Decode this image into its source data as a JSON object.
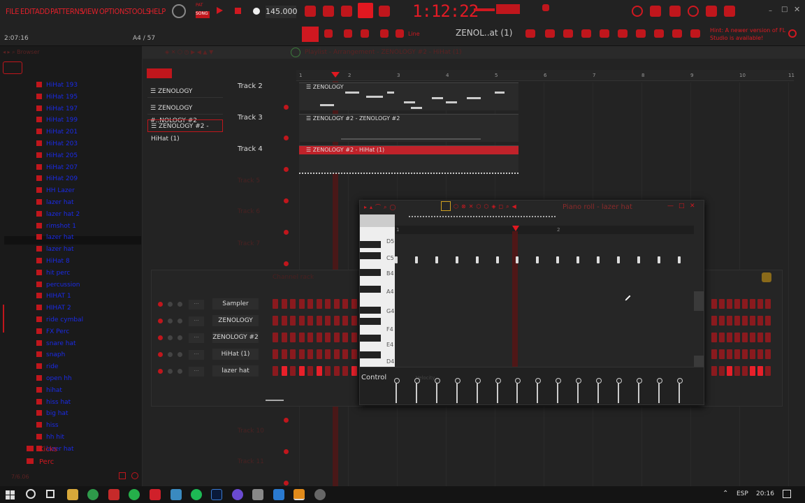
{
  "menu": [
    "FILE",
    "EDIT",
    "ADD",
    "PATTERNS",
    "VIEW",
    "OPTIONS",
    "TOOLS",
    "HELP"
  ],
  "transport": {
    "pat_label": "PAT",
    "song_label": "SONG",
    "tempo": "145.000",
    "clock": "1:12:22"
  },
  "toolbar": {
    "pattern_name": "ZENOL..at (1)",
    "line_label": "Line"
  },
  "hint": "Hint: A newer version of FL Studio is available!",
  "status": {
    "time": "2:07:16",
    "page": "A4 / 57"
  },
  "browser": {
    "items": [
      "HiHat 193",
      "HiHat 195",
      "HiHat 197",
      "HiHat 199",
      "HiHat 201",
      "HiHat 203",
      "HiHat 205",
      "HiHat 207",
      "HiHat 209",
      "HH Lazer",
      "lazer hat",
      "lazer hat 2",
      "rimshot 1",
      "lazer hat",
      "lazer hat",
      "HiHat 8",
      "hit perc",
      "percussion",
      "HIHAT 1",
      "HIHAT 2",
      "ride cymbal",
      "FX Perc",
      "snare hat",
      "snaph",
      "ride",
      "open hh",
      "hihat",
      "hiss hat",
      "big hat",
      "hiss",
      "hh hit",
      "lazer hat"
    ],
    "folders": [
      "Kicks",
      "Perc"
    ],
    "footer": "7/6.06"
  },
  "playlist": {
    "title": "Playlist - Arrangement - ZENOLOGY #2 - HiHat (1)",
    "ruler": [
      "1",
      "2",
      "3",
      "4",
      "5",
      "6",
      "7",
      "8",
      "9",
      "10",
      "11"
    ],
    "patterns": [
      "ZENOLOGY",
      "ZENOLOGY #..NOLOGY #2",
      "ZENOLOGY #2 - HiHat (1)"
    ],
    "tracks": [
      "Track 2",
      "Track 3",
      "Track 4"
    ],
    "faint_tracks": [
      "Track 5",
      "Track 6",
      "Track 7",
      "Track 10",
      "Track 11"
    ],
    "clips": [
      "ZENOLOGY",
      "ZENOLOGY #2 - ZENOLOGY #2",
      "ZENOLOGY #2 - HiHat (1)"
    ]
  },
  "pianoroll": {
    "title": "Piano roll - lazer hat",
    "keys": [
      "D5",
      "C5",
      "B4",
      "A4",
      "G4",
      "F4",
      "E4",
      "D4"
    ],
    "control_label": "Control",
    "velocity_label": "Velocity",
    "ruler": [
      "1",
      "2"
    ]
  },
  "channelrack": {
    "title": "Channel rack",
    "channels": [
      "Sampler",
      "ZENOLOGY",
      "ZENOLOGY #2",
      "HiHat (1)",
      "lazer hat"
    ]
  },
  "taskbar": {
    "lang": "ESP",
    "time": "20:16"
  }
}
